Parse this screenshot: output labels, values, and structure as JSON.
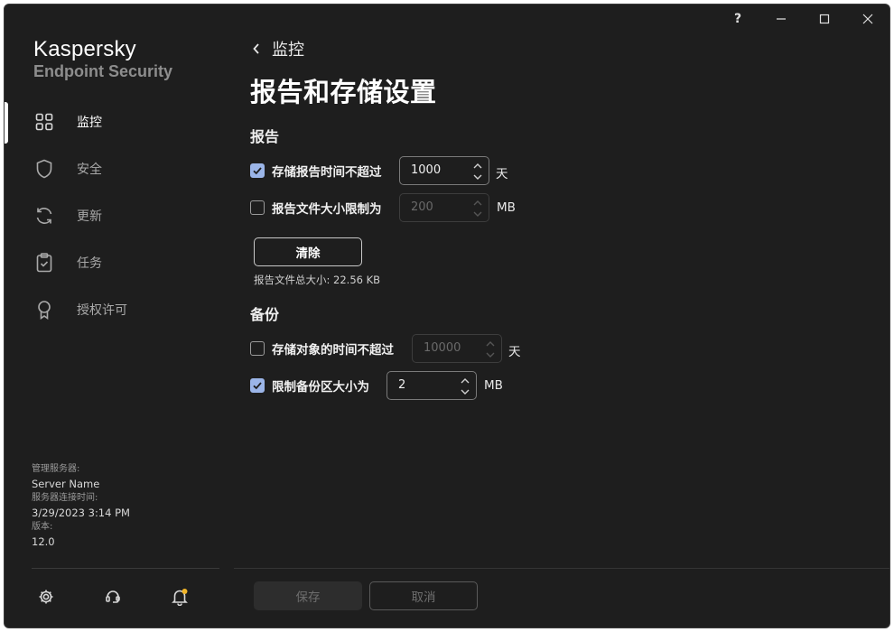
{
  "app": {
    "brand_line1": "Kaspersky",
    "brand_line2": "Endpoint Security"
  },
  "window_controls": {
    "help": "?",
    "minimize": "minimize",
    "maximize": "maximize",
    "close": "close"
  },
  "sidebar": {
    "items": [
      {
        "label": "监控",
        "icon": "monitoring-grid-icon",
        "active": true
      },
      {
        "label": "安全",
        "icon": "shield-icon",
        "active": false
      },
      {
        "label": "更新",
        "icon": "refresh-icon",
        "active": false
      },
      {
        "label": "任务",
        "icon": "clipboard-icon",
        "active": false
      },
      {
        "label": "授权许可",
        "icon": "license-ribbon-icon",
        "active": false
      }
    ],
    "server": {
      "server_label": "管理服务器:",
      "server_value": "Server Name",
      "conn_label": "服务器连接时间:",
      "conn_value": "3/29/2023 3:14 PM",
      "version_label": "版本:",
      "version_value": "12.0"
    },
    "bottom_icons": [
      "gear-icon",
      "support-icon",
      "notification-bell-icon"
    ]
  },
  "header": {
    "back_label": "监控",
    "title": "报告和存储设置"
  },
  "reports": {
    "heading": "报告",
    "store_time": {
      "label": "存储报告时间不超过",
      "checked": true,
      "value": "1000",
      "unit": "天"
    },
    "size_limit": {
      "label": "报告文件大小限制为",
      "checked": false,
      "value": "200",
      "unit": "MB"
    },
    "clear_button": "清除",
    "total_size": "报告文件总大小: 22.56 KB"
  },
  "backup": {
    "heading": "备份",
    "store_time": {
      "label": "存储对象的时间不超过",
      "checked": false,
      "value": "10000",
      "unit": "天"
    },
    "size_limit": {
      "label": "限制备份区大小为",
      "checked": true,
      "value": "2",
      "unit": "MB"
    }
  },
  "footer": {
    "save_label": "保存",
    "cancel_label": "取消"
  },
  "colors": {
    "background": "#1e1e1e",
    "checkbox_accent": "#9bb5e8",
    "notification_dot": "#f0b429"
  }
}
